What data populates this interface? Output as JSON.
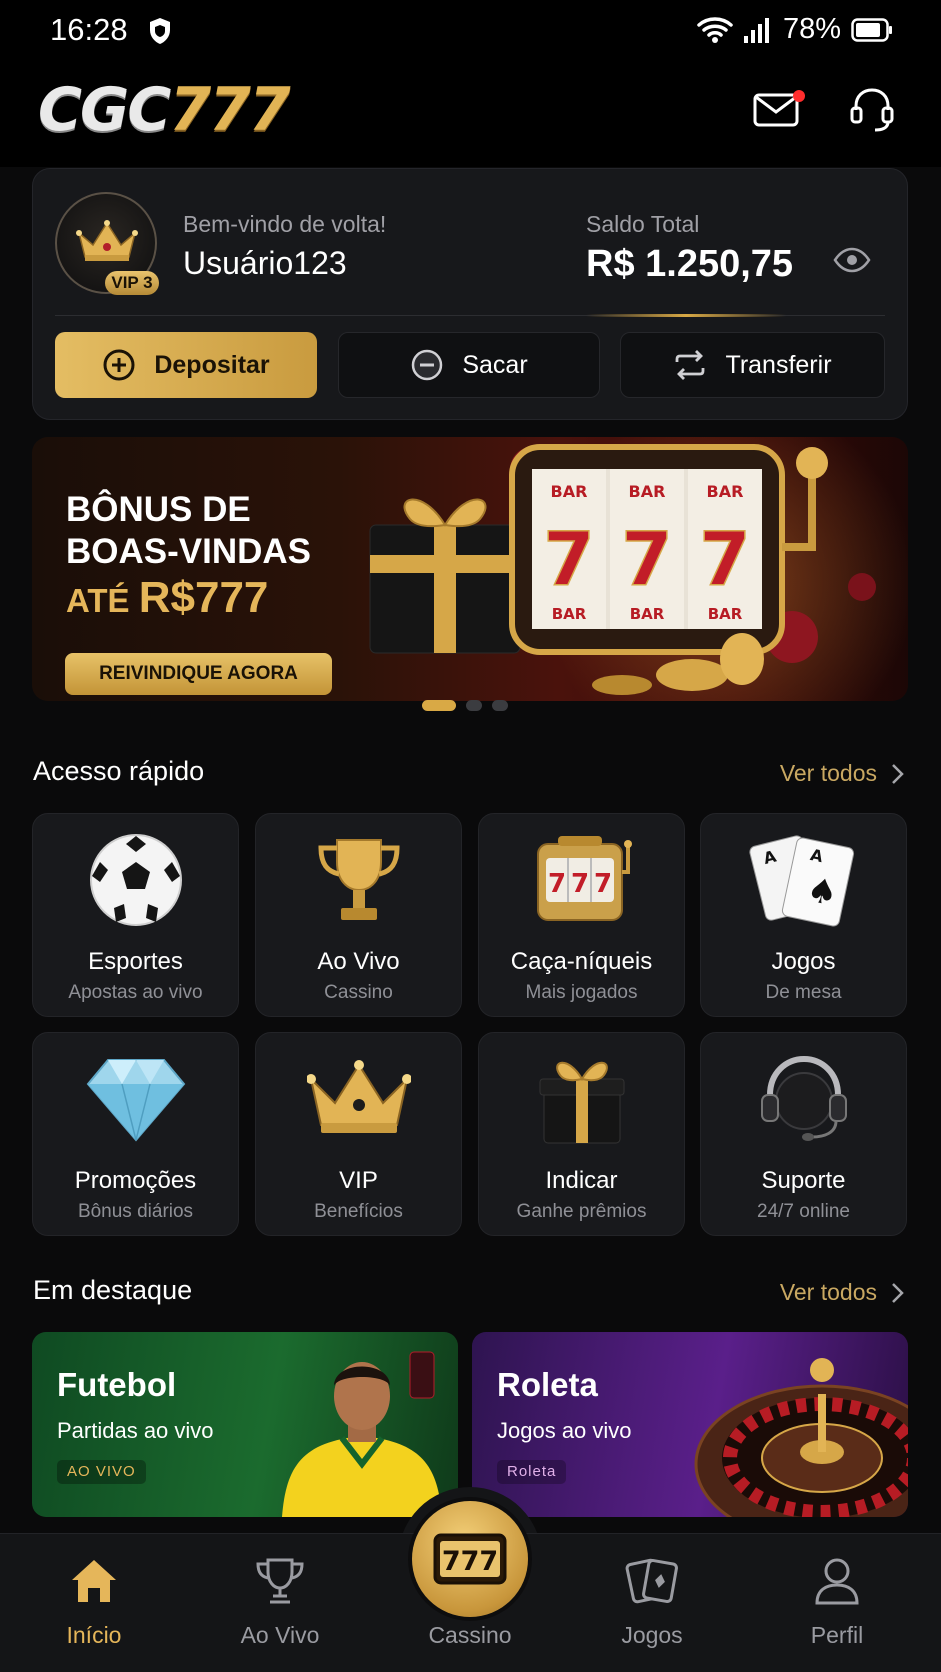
{
  "status_bar": {
    "time": "16:28",
    "battery": "78%"
  },
  "header": {
    "logo_main": "CGC",
    "logo_num": "777"
  },
  "account": {
    "welcome": "Bem-vindo de volta!",
    "username": "Usuário123",
    "vip_level": "VIP 3",
    "balance_label": "Saldo Total",
    "balance_value": "R$ 1.250,75",
    "buttons": {
      "deposit": "Depositar",
      "withdraw": "Sacar",
      "transfer": "Transferir"
    }
  },
  "banner": {
    "line1": "BÔNUS DE",
    "line2": "BOAS-VINDAS",
    "prefix": "ATÉ",
    "amount": "R$777",
    "cta": "REIVINDIQUE AGORA",
    "slot_digits": [
      "7",
      "7",
      "7"
    ],
    "reel_label": "BAR"
  },
  "quick_access": {
    "title": "Acesso rápido",
    "see_all": "Ver todos",
    "items": [
      {
        "title": "Esportes",
        "subtitle": "Apostas ao vivo",
        "icon": "soccer-ball-icon"
      },
      {
        "title": "Ao Vivo",
        "subtitle": "Cassino",
        "icon": "trophy-icon"
      },
      {
        "title": "Caça-níqueis",
        "subtitle": "Mais jogados",
        "icon": "slot-machine-icon"
      },
      {
        "title": "Jogos",
        "subtitle": "De mesa",
        "icon": "playing-cards-icon"
      },
      {
        "title": "Promoções",
        "subtitle": "Bônus diários",
        "icon": "diamond-icon"
      },
      {
        "title": "VIP",
        "subtitle": "Benefícios",
        "icon": "crown-icon"
      },
      {
        "title": "Indicar",
        "subtitle": "Ganhe prêmios",
        "icon": "gift-icon"
      },
      {
        "title": "Suporte",
        "subtitle": "24/7 online",
        "icon": "headset-icon"
      }
    ]
  },
  "featured": {
    "title": "Em destaque",
    "see_all": "Ver todos",
    "cards": [
      {
        "title": "Futebol",
        "subtitle": "Partidas ao vivo",
        "tag": "AO VIVO"
      },
      {
        "title": "Roleta",
        "subtitle": "Jogos ao vivo",
        "tag": "Roleta"
      }
    ]
  },
  "bottom_nav": {
    "items": [
      {
        "label": "Início",
        "icon": "home-icon",
        "active": true
      },
      {
        "label": "Ao Vivo",
        "icon": "trophy-icon"
      },
      {
        "label": "Cassino",
        "icon": "slot-777-icon",
        "center_text": "777"
      },
      {
        "label": "Jogos",
        "icon": "cards-icon"
      },
      {
        "label": "Perfil",
        "icon": "user-icon"
      }
    ]
  },
  "colors": {
    "gold": "#e5b65a",
    "background": "#0a0a0b",
    "card": "#17181b",
    "notification": "#ff2d2d"
  }
}
